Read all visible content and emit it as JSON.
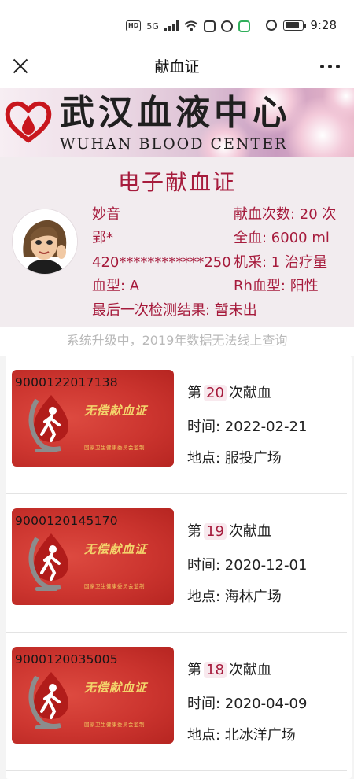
{
  "status_bar": {
    "network_badge": "HD",
    "network_type": "5G",
    "time": "9:28"
  },
  "nav": {
    "title": "献血证"
  },
  "banner": {
    "name_cn": "武汉血液中心",
    "name_en": "WUHAN BLOOD CENTER"
  },
  "certificate": {
    "title": "电子献血证",
    "name_line1": "妙音",
    "name_line2": "郢*",
    "id_number": "420************250",
    "blood_type": "血型: A",
    "donation_count": "献血次数: 20 次",
    "whole_blood": "全血: 6000 ml",
    "apheresis": "机采: 1 治疗量",
    "rh_type": "Rh血型: 阳性",
    "latest_test": "最后一次检测结果: 暂未出"
  },
  "notice": "系统升级中，2019年数据无法线上查询",
  "card_common": {
    "card_title": "无偿献血证",
    "card_issuer": "国家卫生健康委员会监制"
  },
  "records": [
    {
      "card_number": "9000122017138",
      "prefix": "第",
      "count": "20",
      "suffix": "次献血",
      "time": "时间:  2022-02-21",
      "place": "地点:  服投广场"
    },
    {
      "card_number": "9000120145170",
      "prefix": "第",
      "count": "19",
      "suffix": "次献血",
      "time": "时间:  2020-12-01",
      "place": "地点:  海林广场"
    },
    {
      "card_number": "9000120035005",
      "prefix": "第",
      "count": "18",
      "suffix": "次献血",
      "time": "时间:  2020-04-09",
      "place": "地点:  北冰洋广场"
    }
  ]
}
